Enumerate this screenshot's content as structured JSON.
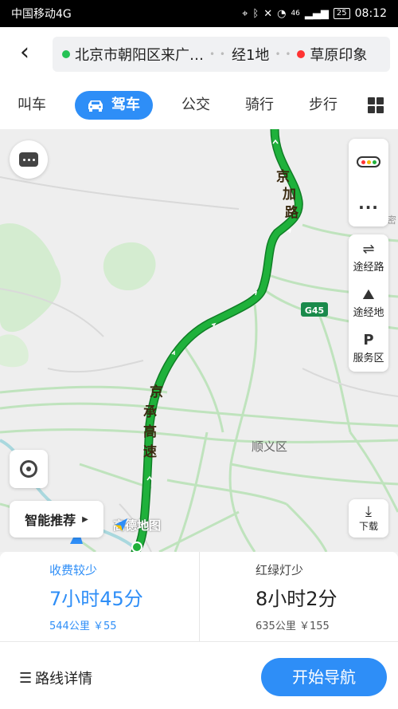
{
  "status_bar": {
    "carrier": "中国移动4G",
    "battery": "25",
    "network": "46",
    "time": "08:12"
  },
  "header": {
    "origin": "北京市朝阳区来广…",
    "waypoints": "经1地",
    "destination": "草原印象",
    "tabs": [
      {
        "label": "叫车"
      },
      {
        "label": "驾车",
        "active": true
      },
      {
        "label": "公交"
      },
      {
        "label": "骑行"
      },
      {
        "label": "步行"
      }
    ]
  },
  "map": {
    "road_labels": {
      "jingjia_1": "京",
      "jingjia_2": "加",
      "jingjia_3": "路",
      "jingcheng_1": "京",
      "jingcheng_2": "承",
      "jingcheng_3": "高",
      "jingcheng_4": "速"
    },
    "highway_shield": "G45",
    "district_label": "顺义区",
    "edge_label": "密",
    "logo_text": "高德地图",
    "route_color": "#1fb13b",
    "buttons": {
      "via_road": "途经路",
      "via_place": "途经地",
      "service_area": "服务区",
      "smart_recommend": "智能推荐",
      "download": "下载"
    }
  },
  "routes": [
    {
      "tag": "收费较少",
      "time": "7小时45分",
      "distance": "544公里",
      "toll": "￥55",
      "selected": true
    },
    {
      "tag": "红绿灯少",
      "time": "8小时2分",
      "distance": "635公里",
      "toll": "￥155",
      "selected": false
    }
  ],
  "footer": {
    "detail_label": "路线详情",
    "start_label": "开始导航"
  },
  "colors": {
    "accent": "#2e8ef7",
    "route": "#1fb13b",
    "origin_dot": "#25c255",
    "dest_dot": "#ff3333"
  }
}
